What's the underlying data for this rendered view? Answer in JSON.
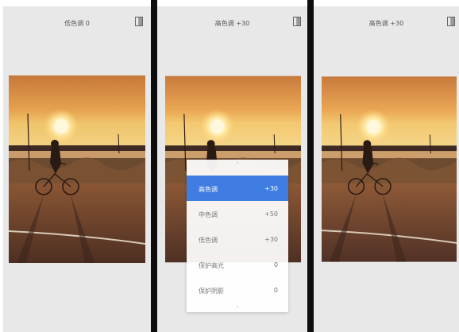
{
  "screens": [
    {
      "title": "低色调 0"
    },
    {
      "title": "高色调 +30"
    },
    {
      "title": "高色调 +30"
    }
  ],
  "icons": {
    "compare": "compare-icon",
    "chevron_up": "chevron-up-icon",
    "chevron_down": "chevron-down-icon"
  },
  "menu": {
    "items": [
      {
        "label": "高色调",
        "value": "+30",
        "selected": true
      },
      {
        "label": "中色调",
        "value": "+50",
        "selected": false
      },
      {
        "label": "低色调",
        "value": "+30",
        "selected": false
      },
      {
        "label": "保护高光",
        "value": "0",
        "selected": false
      },
      {
        "label": "保护阴影",
        "value": "0",
        "selected": false
      }
    ]
  },
  "colors": {
    "accent": "#3f7de2",
    "divider": "#0d0d0d",
    "panel_bg": "#e8e8e8"
  }
}
